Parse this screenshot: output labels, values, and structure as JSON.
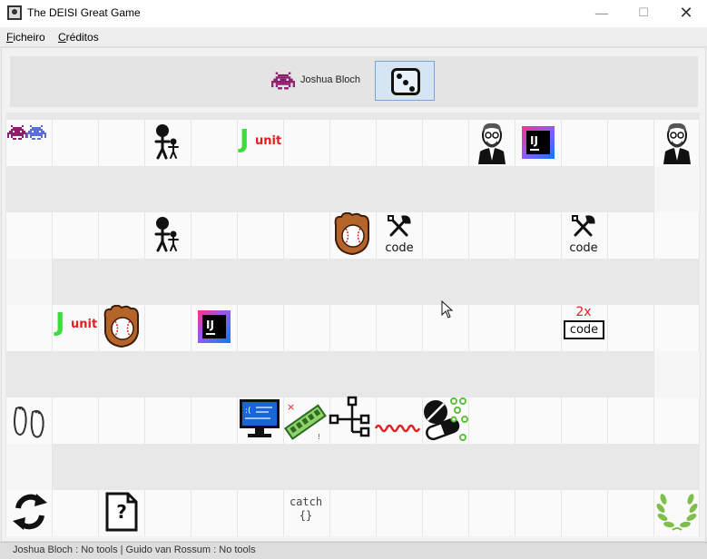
{
  "window": {
    "title": "The DEISI Great Game",
    "minimize_glyph": "—",
    "maximize_glyph": "☐",
    "close_glyph": "✕"
  },
  "menu": {
    "items": [
      {
        "label": "Ficheiro"
      },
      {
        "label": "Créditos"
      }
    ]
  },
  "header": {
    "current_player": "Joshua Bloch",
    "player_icon": "purple-invader-icon",
    "dice_button": "dice-icon"
  },
  "board": {
    "rows": 5,
    "cells_per_row": 15,
    "squares": [
      {
        "row": 1,
        "col": 1,
        "content": "players",
        "icons": [
          "purple-invader-icon",
          "blue-invader-icon"
        ]
      },
      {
        "row": 1,
        "col": 4,
        "content": "inheritance",
        "icon": "inheritance-icon"
      },
      {
        "row": 1,
        "col": 6,
        "content": "junit",
        "icon": "junit-icon",
        "text": "unit"
      },
      {
        "row": 1,
        "col": 11,
        "content": "programmer",
        "icon": "programmer-icon"
      },
      {
        "row": 1,
        "col": 12,
        "content": "ide",
        "icon": "intellij-icon",
        "text": "IJ"
      },
      {
        "row": 1,
        "col": 15,
        "content": "programmer",
        "icon": "programmer-icon"
      },
      {
        "row": 2,
        "col": 4,
        "content": "inheritance",
        "icon": "inheritance-icon"
      },
      {
        "row": 2,
        "col": 8,
        "content": "exception",
        "icon": "baseball-glove-icon"
      },
      {
        "row": 2,
        "col": 9,
        "content": "tools",
        "icon": "tools-icon",
        "text": "code"
      },
      {
        "row": 2,
        "col": 13,
        "content": "tools",
        "icon": "tools-icon",
        "text": "code"
      },
      {
        "row": 3,
        "col": 2,
        "content": "junit",
        "icon": "junit-icon",
        "text": "unit"
      },
      {
        "row": 3,
        "col": 3,
        "content": "exception",
        "icon": "baseball-glove-icon"
      },
      {
        "row": 3,
        "col": 5,
        "content": "ide",
        "icon": "intellij-icon",
        "text": "IJ"
      },
      {
        "row": 3,
        "col": 13,
        "content": "duplicated-code",
        "icon": "duplicated-code-icon",
        "top_text": "2x",
        "text": "code"
      },
      {
        "row": 4,
        "col": 1,
        "content": "footprints",
        "icon": "footprints-icon"
      },
      {
        "row": 4,
        "col": 6,
        "content": "blue-screen",
        "icon": "blue-screen-icon"
      },
      {
        "row": 4,
        "col": 7,
        "content": "memory",
        "icon": "memory-icon"
      },
      {
        "row": 4,
        "col": 8,
        "content": "tree",
        "icon": "tree-icon"
      },
      {
        "row": 4,
        "col": 9,
        "content": "side-effects",
        "icon": "side-effects-icon"
      },
      {
        "row": 4,
        "col": 10,
        "content": "pills",
        "icon": "pills-icon"
      },
      {
        "row": 5,
        "col": 1,
        "content": "cycle",
        "icon": "cycle-icon"
      },
      {
        "row": 5,
        "col": 3,
        "content": "unknown",
        "icon": "unknown-file-icon",
        "text": "?"
      },
      {
        "row": 5,
        "col": 7,
        "content": "catch",
        "icon": "catch-icon",
        "text": "catch",
        "text2": "{}"
      },
      {
        "row": 5,
        "col": 15,
        "content": "finish",
        "icon": "laurel-icon"
      }
    ]
  },
  "colors": {
    "junit_j": "#3ddc3d",
    "junit_text": "#e02020",
    "invader_purple": "#8e1f6e",
    "invader_blue": "#5a6fd6",
    "dice_bg": "#d6e5f3",
    "laurel": "#7dbf4a"
  },
  "status": {
    "text": "Joshua Bloch : No tools | Guido van Rossum : No tools"
  }
}
